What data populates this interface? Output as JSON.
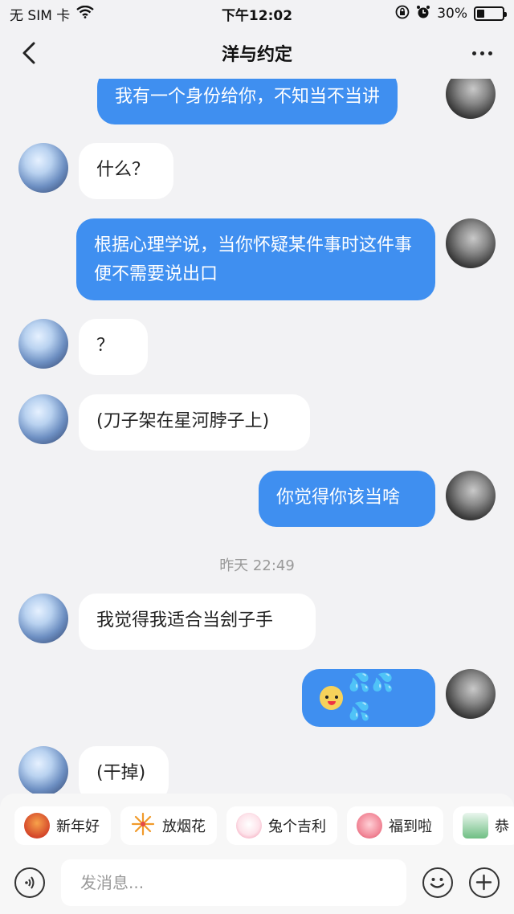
{
  "status_bar": {
    "carrier": "无 SIM 卡",
    "time": "下午12:02",
    "battery": "30%",
    "battery_level": 0.3,
    "icons": [
      "wifi-icon",
      "rotation-lock-icon",
      "alarm-icon",
      "battery-icon"
    ]
  },
  "nav": {
    "title": "洋与约定",
    "back_icon": "chevron-left-icon",
    "more_icon": "more-horizontal-icon"
  },
  "messages": [
    {
      "side": "right",
      "text": "我有一个身份给你，不知当不当讲"
    },
    {
      "side": "left",
      "text": "什么？"
    },
    {
      "side": "right",
      "text": "根据心理学说，当你怀疑某件事时这件事便不需要说出口"
    },
    {
      "side": "left",
      "text": "？"
    },
    {
      "side": "left",
      "text": "(刀子架在星河脖子上)"
    },
    {
      "side": "right",
      "text": "你觉得你该当啥"
    },
    {
      "side": "left",
      "text": "我觉得我适合当刽子手"
    },
    {
      "side": "right",
      "text": "",
      "emoji": [
        "smiling-face-emoji",
        "sweat-droplets-emoji",
        "sweat-droplets-emoji",
        "sweat-droplets-emoji"
      ]
    },
    {
      "side": "left",
      "text": "(干掉)"
    }
  ],
  "timestamp": "昨天 22:49",
  "quick_replies": [
    {
      "label": "新年好",
      "icon": "monkey-greeting-icon"
    },
    {
      "label": "放烟花",
      "icon": "firework-icon"
    },
    {
      "label": "兔个吉利",
      "icon": "rabbit-icon"
    },
    {
      "label": "福到啦",
      "icon": "pig-icon"
    },
    {
      "label": "恭",
      "icon": "mahjong-tile-icon"
    }
  ],
  "input": {
    "placeholder": "发消息...",
    "voice_icon": "voice-icon",
    "emoji_icon": "smile-icon",
    "plus_icon": "plus-icon"
  },
  "colors": {
    "outgoing_bubble": "#3f8ff0",
    "incoming_bubble": "#ffffff",
    "background": "#f2f2f4"
  }
}
